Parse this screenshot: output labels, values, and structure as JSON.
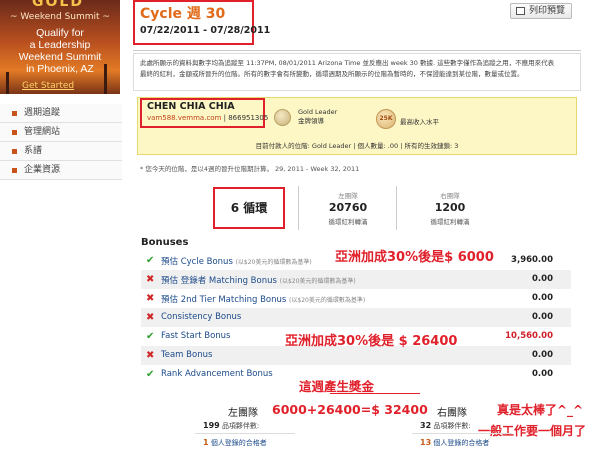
{
  "promo": {
    "gold_text": "GOLD",
    "subtitle": "~ Weekend Summit ~",
    "lines": [
      "Qualify for",
      "a Leadership",
      "Weekend Summit",
      "in Phoenix, AZ"
    ],
    "cta": "Get Started"
  },
  "nav": {
    "items": [
      {
        "label": "週期追蹤"
      },
      {
        "label": "管理網站"
      },
      {
        "label": "系譜"
      },
      {
        "label": "企業資源"
      }
    ]
  },
  "header": {
    "title": "Cycle 週 30",
    "dates": "07/22/2011 - 07/28/2011",
    "print_label": "列印預覽"
  },
  "notice": {
    "line1": "此處所顯示的資料與數字均為追蹤至 11:37PM, 08/01/2011 Arizona Time 並反應出 week 30 數據. 這些數字僅作為追蹤之用，不應用來代表",
    "line2": "最終的紅利，金額或所晉升的位階。所有的數字會有所變動，循環週期及所顯示的位階為暫時的，不保證能達到某位階，數量或位置。"
  },
  "member": {
    "name": "CHEN CHIA CHIA",
    "site": "vam588.vemma.com",
    "id": "866951305",
    "rank_en": "Gold Leader",
    "rank_zh": "金牌領導",
    "income_badge": "25K",
    "income_label": "最高收入水平",
    "stat_line": "目前付款人的位階: Gold Leader | 個人數量: .00 | 所有的生效鏈鎖: 3"
  },
  "footnote": "* 您今天的位階，是以4週的晉升位階期計算。 29, 2011 - Week 32, 2011",
  "cycles": {
    "value": "6 循環",
    "left_label": "左團隊",
    "left_value": "20760",
    "left_sub": "循環紅利轉滿",
    "right_label": "右團隊",
    "right_value": "1200",
    "right_sub": "循環紅利轉滿"
  },
  "bonuses": {
    "title": "Bonuses",
    "rows": [
      {
        "status": "check",
        "name": "預估 Cycle Bonus",
        "note": "(以$20美元的循環數為基準)",
        "amount": "3,960.00",
        "highlight": false
      },
      {
        "status": "cross",
        "name": "預估 登錄者 Matching Bonus",
        "note": "(以$20美元的循環數為基準)",
        "amount": "0.00",
        "highlight": false
      },
      {
        "status": "cross",
        "name": "預估 2nd Tier Matching Bonus",
        "note": "(以$20美元的循環數為基準)",
        "amount": "0.00",
        "highlight": false
      },
      {
        "status": "cross",
        "name": "Consistency Bonus",
        "note": "",
        "amount": "0.00",
        "highlight": false
      },
      {
        "status": "check",
        "name": "Fast Start Bonus",
        "note": "",
        "amount": "10,560.00",
        "highlight": true
      },
      {
        "status": "cross",
        "name": "Team Bonus",
        "note": "",
        "amount": "0.00",
        "highlight": false
      },
      {
        "status": "check",
        "name": "Rank Advancement Bonus",
        "note": "",
        "amount": "0.00",
        "highlight": false
      }
    ]
  },
  "annotations": {
    "a1": "亞洲加成30%後是$ 6000",
    "a2": "亞洲加成30%後是 $ 26400",
    "a3": "這週產生獎金",
    "a4": "6000+26400=$ 32400",
    "a5": "真是太棒了^_^",
    "a6": "一般工作要一個月了"
  },
  "teams": {
    "left_label": "左團隊",
    "right_label": "右團隊",
    "left_count": "199",
    "right_count": "32",
    "count_suffix": "品項夥伴數:",
    "left_q": "1",
    "right_q": "13",
    "q_suffix": "個人登錄的合格者"
  },
  "colors": {
    "accent_orange": "#e06a18",
    "annotation_red": "#e0202a",
    "panel_yellow": "#fdf7c5",
    "check_green": "#2f9d2f"
  }
}
